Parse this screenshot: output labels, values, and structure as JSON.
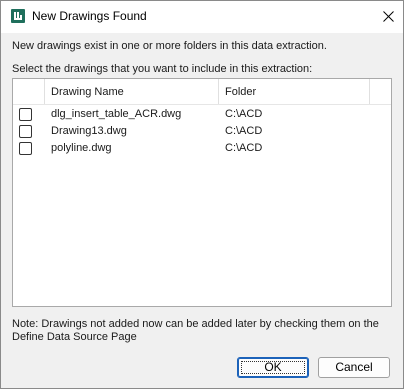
{
  "window": {
    "title": "New Drawings Found",
    "app_icon": "autocad-data-extraction-icon",
    "close_icon": "close-icon"
  },
  "info_text": "New drawings exist in one or more folders in this data extraction.",
  "select_text": "Select the drawings that you want to include in this extraction:",
  "list": {
    "columns": [
      "",
      "Drawing Name",
      "Folder"
    ],
    "rows": [
      {
        "checked": false,
        "name": "dlg_insert_table_ACR.dwg",
        "folder": "C:\\ACD"
      },
      {
        "checked": false,
        "name": "Drawing13.dwg",
        "folder": "C:\\ACD"
      },
      {
        "checked": false,
        "name": "polyline.dwg",
        "folder": "C:\\ACD"
      }
    ]
  },
  "note": "Note: Drawings not added now can be added later by checking them on the Define Data Source Page",
  "buttons": {
    "ok": "OK",
    "cancel": "Cancel"
  },
  "colors": {
    "accent": "#1c62b9",
    "icon_green": "#1f6f5c"
  }
}
